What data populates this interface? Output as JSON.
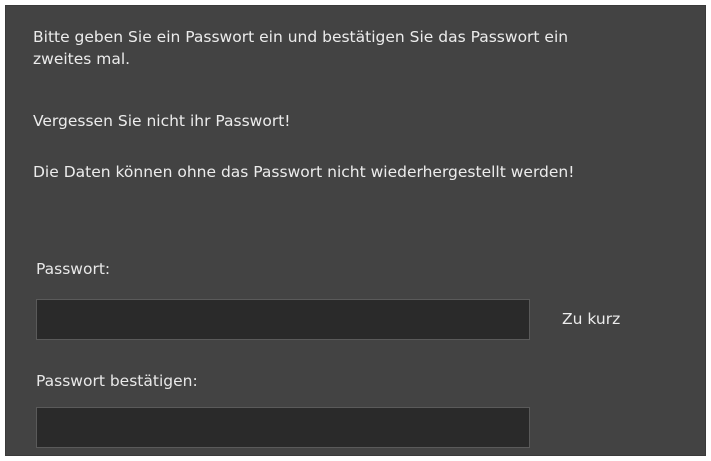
{
  "intro": {
    "line1": "Bitte geben Sie ein Passwort ein und bestätigen Sie das Passwort ein",
    "line2": "zweites mal.",
    "reminder": "Vergessen Sie nicht ihr Passwort!",
    "warning": "Die Daten können ohne das Passwort nicht wiederhergestellt werden!"
  },
  "password": {
    "label": "Passwort:",
    "value": "",
    "status": "Zu kurz"
  },
  "confirm": {
    "label": "Passwort bestätigen:",
    "value": ""
  },
  "colors": {
    "panel_background": "#434343",
    "field_background": "#2a2a2a",
    "text": "#ececec"
  }
}
